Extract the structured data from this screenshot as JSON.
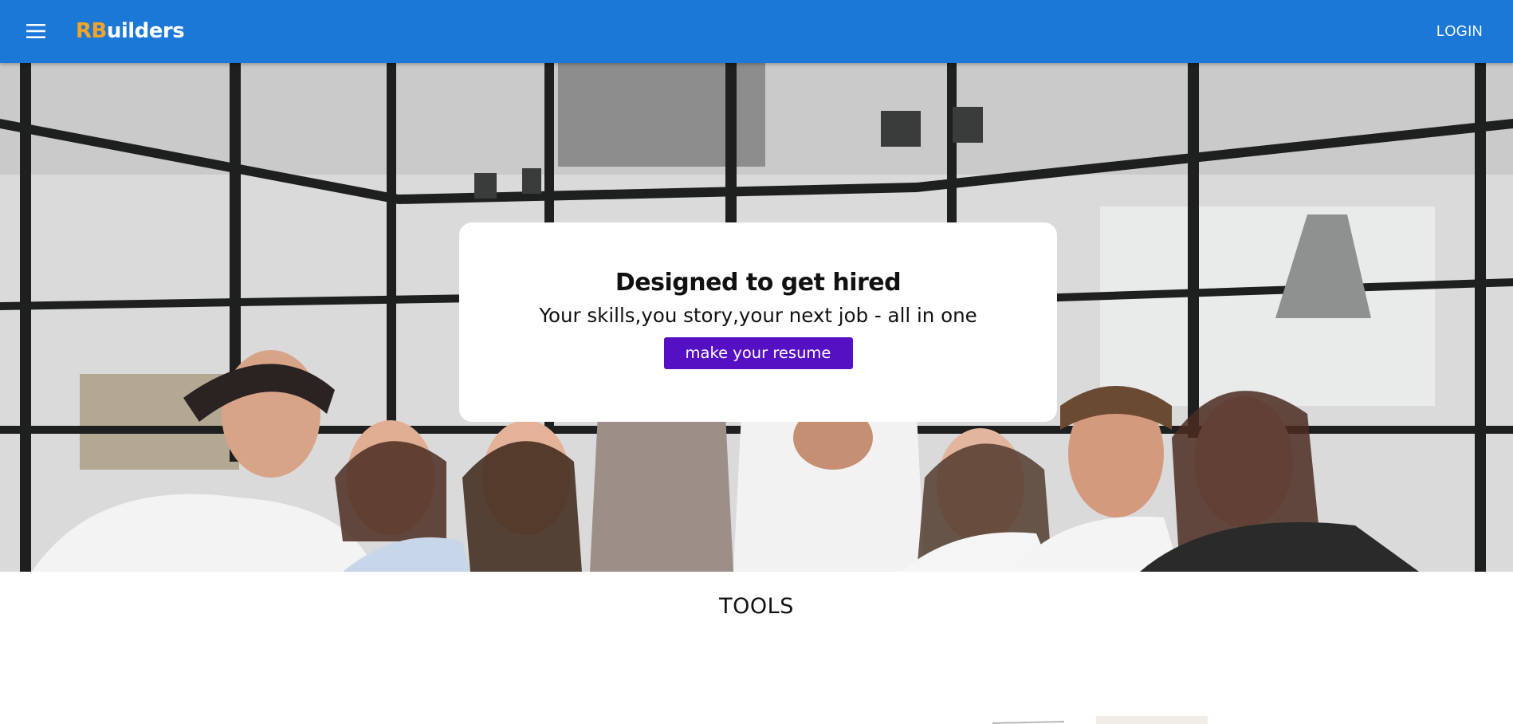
{
  "appbar": {
    "menu_icon": "hamburger-menu-icon",
    "logo_prefix": "RB",
    "logo_suffix": "uilders",
    "login_label": "LOGIN",
    "colors": {
      "bar": "#1b78d6",
      "logo_prefix": "#f4a324"
    }
  },
  "hero": {
    "image": "office-team-photo",
    "card": {
      "title": "Designed to get hired",
      "subtitle": "Your skills,you story,your next job - all in one",
      "cta_label": "make your resume",
      "cta_color": "#5610c4"
    }
  },
  "tools": {
    "title": "TOOLS"
  }
}
